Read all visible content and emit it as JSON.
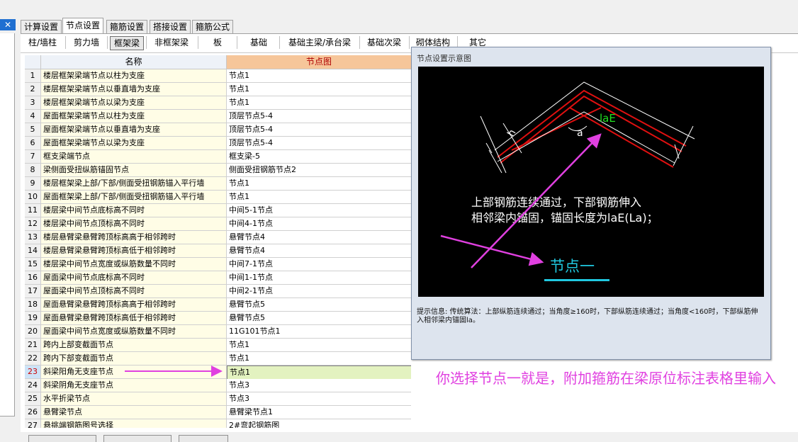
{
  "window": {
    "close_glyph": "✕"
  },
  "tabs": [
    "计算设置",
    "节点设置",
    "箍筋设置",
    "搭接设置",
    "箍筋公式"
  ],
  "subtabs": [
    "柱/墙柱",
    "剪力墙",
    "框架梁",
    "非框架梁",
    "板",
    "基础",
    "基础主梁/承台梁",
    "基础次梁",
    "砌体结构",
    "其它"
  ],
  "grid": {
    "headers": {
      "name": "名称",
      "node": "节点图"
    },
    "rows": [
      {
        "no": "1",
        "name": "楼层框架梁端节点以柱为支座",
        "node": "节点1"
      },
      {
        "no": "2",
        "name": "楼层框架梁端节点以垂直墙为支座",
        "node": "节点1"
      },
      {
        "no": "3",
        "name": "楼层框架梁端节点以梁为支座",
        "node": "节点1"
      },
      {
        "no": "4",
        "name": "屋面框架梁端节点以柱为支座",
        "node": "顶层节点5-4"
      },
      {
        "no": "5",
        "name": "屋面框架梁端节点以垂直墙为支座",
        "node": "顶层节点5-4"
      },
      {
        "no": "6",
        "name": "屋面框架梁端节点以梁为支座",
        "node": "顶层节点5-4"
      },
      {
        "no": "7",
        "name": "框支梁端节点",
        "node": "框支梁-5"
      },
      {
        "no": "8",
        "name": "梁侧面受扭纵筋锚固节点",
        "node": "侧面受扭钢筋节点2"
      },
      {
        "no": "9",
        "name": "楼层框架梁上部/下部/侧面受扭钢筋锚入平行墙",
        "node": "节点1"
      },
      {
        "no": "10",
        "name": "屋面框架梁上部/下部/侧面受扭钢筋锚入平行墙",
        "node": "节点1"
      },
      {
        "no": "11",
        "name": "楼层梁中间节点底标高不同时",
        "node": "中间5-1节点"
      },
      {
        "no": "12",
        "name": "楼层梁中间节点顶标高不同时",
        "node": "中间4-1节点"
      },
      {
        "no": "13",
        "name": "楼层悬臂梁悬臂跨顶标高高于相邻跨时",
        "node": "悬臂节点4"
      },
      {
        "no": "14",
        "name": "楼层悬臂梁悬臂跨顶标高低于相邻跨时",
        "node": "悬臂节点4"
      },
      {
        "no": "15",
        "name": "楼层梁中间节点宽度或纵筋数量不同时",
        "node": "中间7-1节点"
      },
      {
        "no": "16",
        "name": "屋面梁中间节点底标高不同时",
        "node": "中间1-1节点"
      },
      {
        "no": "17",
        "name": "屋面梁中间节点顶标高不同时",
        "node": "中间2-1节点"
      },
      {
        "no": "18",
        "name": "屋面悬臂梁悬臂跨顶标高高于相邻跨时",
        "node": "悬臂节点5"
      },
      {
        "no": "19",
        "name": "屋面悬臂梁悬臂跨顶标高低于相邻跨时",
        "node": "悬臂节点5"
      },
      {
        "no": "20",
        "name": "屋面梁中间节点宽度或纵筋数量不同时",
        "node": "11G101节点1"
      },
      {
        "no": "21",
        "name": "跨内上部变截面节点",
        "node": "节点1"
      },
      {
        "no": "22",
        "name": "跨内下部变截面节点",
        "node": "节点1"
      },
      {
        "no": "23",
        "name": "斜梁阳角无支座节点",
        "node": "节点1"
      },
      {
        "no": "24",
        "name": "斜梁阴角无支座节点",
        "node": "节点3"
      },
      {
        "no": "25",
        "name": "水平折梁节点",
        "node": "节点3"
      },
      {
        "no": "26",
        "name": "悬臂梁节点",
        "node": "悬臂梁节点1"
      },
      {
        "no": "27",
        "name": "悬挑端钢筋图号选择",
        "node": "2#弯起钢筋图"
      }
    ]
  },
  "dialog": {
    "title": "节点设置示意图",
    "line1": "上部钢筋连续通过，下部钢筋伸入",
    "line2": "相邻梁内锚固，锚固长度为laE(La)；",
    "node_label": "节点一",
    "label_lae": "laE",
    "label_a": "a",
    "label_h": "h",
    "info": "提示信息:  传统算法：上部纵筋连续通过；当角度≥160时，下部纵筋连续通过；当角度<160时，下部纵筋伸入相邻梁内锚固la。"
  },
  "note": "你选择节点一就是，附加箍筋在梁原位标注表格里输入",
  "colors": {
    "annotation": "#e040e0",
    "node_cyan": "#20c8e0",
    "rebar_red": "#e01010"
  }
}
